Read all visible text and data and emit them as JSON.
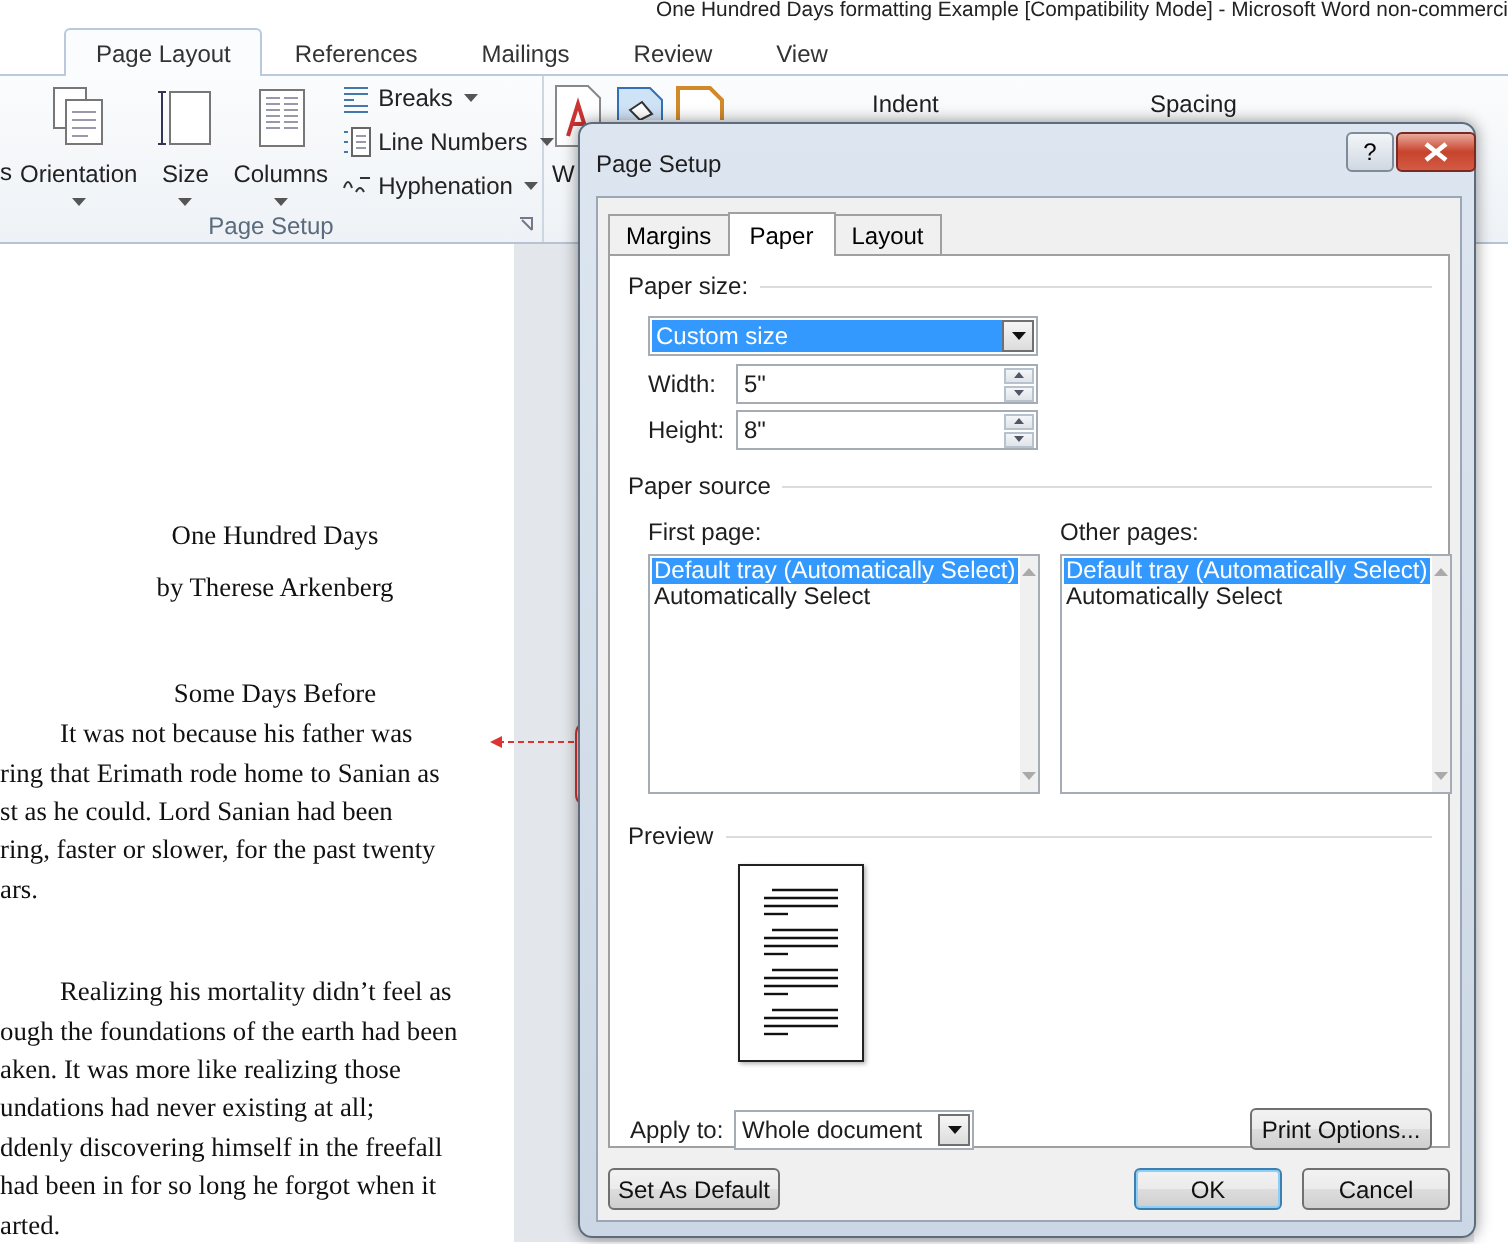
{
  "window": {
    "title": "One Hundred Days formatting Example [Compatibility Mode]  -  Microsoft Word non-commerci"
  },
  "ribbon_tabs": [
    {
      "label": "Page Layout",
      "selected": true
    },
    {
      "label": "References",
      "selected": false
    },
    {
      "label": "Mailings",
      "selected": false
    },
    {
      "label": "Review",
      "selected": false
    },
    {
      "label": "View",
      "selected": false
    }
  ],
  "ribbon": {
    "cut_label": "s",
    "large_buttons": [
      {
        "label": "Orientation",
        "kind": "orientation"
      },
      {
        "label": "Size",
        "kind": "size"
      },
      {
        "label": "Columns",
        "kind": "columns"
      }
    ],
    "small_buttons": [
      {
        "label": "Breaks",
        "kind": "breaks"
      },
      {
        "label": "Line Numbers",
        "kind": "numbers"
      },
      {
        "label": "Hyphenation",
        "kind": "hyphenation"
      }
    ],
    "group_label": "Page Setup",
    "cut_button": "W",
    "indent_label": "Indent",
    "spacing_label": "Spacing"
  },
  "document": {
    "title": "One Hundred Days",
    "author": "by Therese  Arkenberg",
    "heading": "Some Days Before",
    "paragraphs": [
      {
        "lines": [
          "It was not because his father was",
          "ring that Erimath rode home to Sanian as",
          "st as he could. Lord Sanian had been",
          "ring, faster or slower, for the past twenty",
          "ars."
        ]
      },
      {
        "lines": [
          "Realizing his mortality didn’t feel as",
          "ough the foundations of the earth had been",
          "aken. It was more like realizing those",
          "undations had never existing at all;",
          "ddenly discovering himself in the freefall",
          " had been in for so long he forgot when it",
          "arted."
        ]
      }
    ]
  },
  "dialog": {
    "title": "Page Setup",
    "help": "?",
    "tabs": [
      {
        "label": "Margins",
        "selected": false
      },
      {
        "label": "Paper",
        "selected": true
      },
      {
        "label": "Layout",
        "selected": false
      }
    ],
    "paper_size": {
      "legend": "Paper size:",
      "value": "Custom size",
      "focused": true,
      "width_label": "Width:",
      "width": "5\"",
      "height_label": "Height:",
      "height": "8\""
    },
    "paper_source": {
      "legend": "Paper source",
      "lists": [
        {
          "label": "First page:",
          "items": [
            {
              "text": "Default tray (Automatically Select)",
              "selected": true
            },
            {
              "text": "Automatically Select",
              "selected": false
            }
          ]
        },
        {
          "label": "Other pages:",
          "items": [
            {
              "text": "Default tray (Automatically Select)",
              "selected": true
            },
            {
              "text": "Automatically Select",
              "selected": false
            }
          ]
        }
      ]
    },
    "preview": {
      "legend": "Preview"
    },
    "apply_to": {
      "label": "Apply to:",
      "value": "Whole document"
    },
    "print_options": "Print Options...",
    "set_default": "Set As Default",
    "buttons": [
      {
        "label": "OK",
        "default": true
      },
      {
        "label": "Cancel",
        "default": false
      }
    ]
  }
}
